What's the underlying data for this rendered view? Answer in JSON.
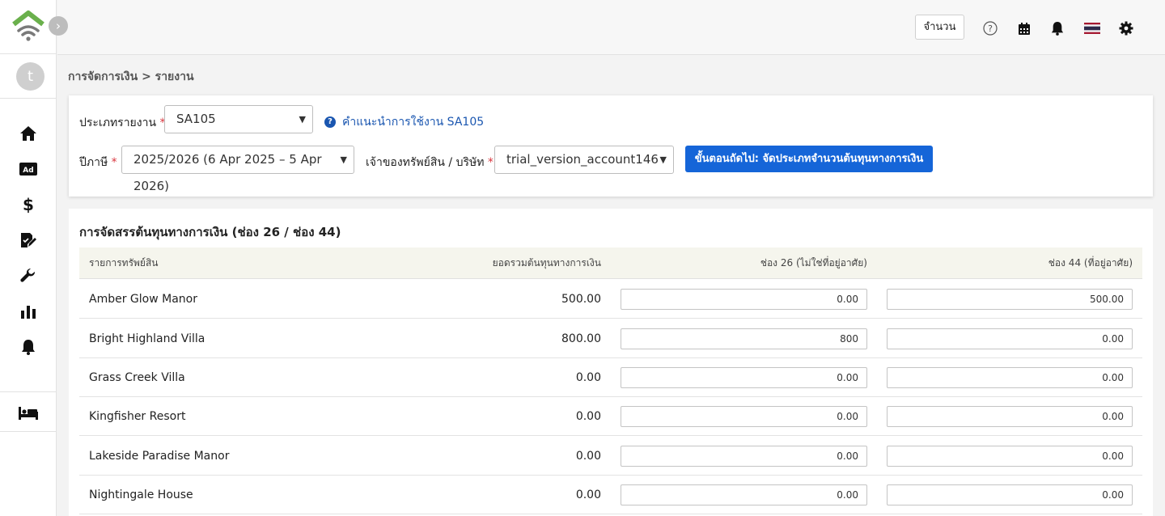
{
  "header": {
    "qty_label": "จำนวน"
  },
  "sidebar": {
    "avatar_initial": "t",
    "icons": [
      "home-icon",
      "ad-icon",
      "dollar-icon",
      "edit-document-icon",
      "wrench-icon",
      "bar-chart-icon",
      "bell-icon",
      "bed-icon"
    ]
  },
  "breadcrumb": "การจัดการเงิน > รายงาน",
  "form": {
    "report_type_label": "ประเภทรายงาน",
    "report_type_value": "SA105",
    "help_link": "คำแนะนำการใช้งาน SA105",
    "tax_year_label": "ปีภาษี",
    "tax_year_value": "2025/2026 (6 Apr 2025 – 5 Apr 2026)",
    "owner_label": "เจ้าของทรัพย์สิน / บริษัท",
    "owner_value": "trial_version_account146",
    "next_button": "ขั้นตอนถัดไป: จัดประเภทจำนวนต้นทุนทางการเงิน",
    "required_mark": "*"
  },
  "table": {
    "title": "การจัดสรรต้นทุนทางการเงิน (ช่อง 26 / ช่อง 44)",
    "columns": {
      "property": "รายการทรัพย์สิน",
      "total": "ยอดรวมต้นทุนทางการเงิน",
      "box26": "ช่อง 26 (ไม่ใช่ที่อยู่อาศัย)",
      "box44": "ช่อง 44 (ที่อยู่อาศัย)"
    },
    "rows": [
      {
        "name": "Amber Glow Manor",
        "total": "500.00",
        "box26": "0.00",
        "box44": "500.00"
      },
      {
        "name": "Bright Highland Villa",
        "total": "800.00",
        "box26": "800",
        "box44": "0.00"
      },
      {
        "name": "Grass Creek Villa",
        "total": "0.00",
        "box26": "0.00",
        "box44": "0.00"
      },
      {
        "name": "Kingfisher Resort",
        "total": "0.00",
        "box26": "0.00",
        "box44": "0.00"
      },
      {
        "name": "Lakeside Paradise Manor",
        "total": "0.00",
        "box26": "0.00",
        "box44": "0.00"
      },
      {
        "name": "Nightingale House",
        "total": "0.00",
        "box26": "0.00",
        "box44": "0.00"
      }
    ]
  },
  "colors": {
    "primary": "#1565d8",
    "logo_green": "#6ab04c",
    "logo_gray": "#7a7a7a"
  }
}
